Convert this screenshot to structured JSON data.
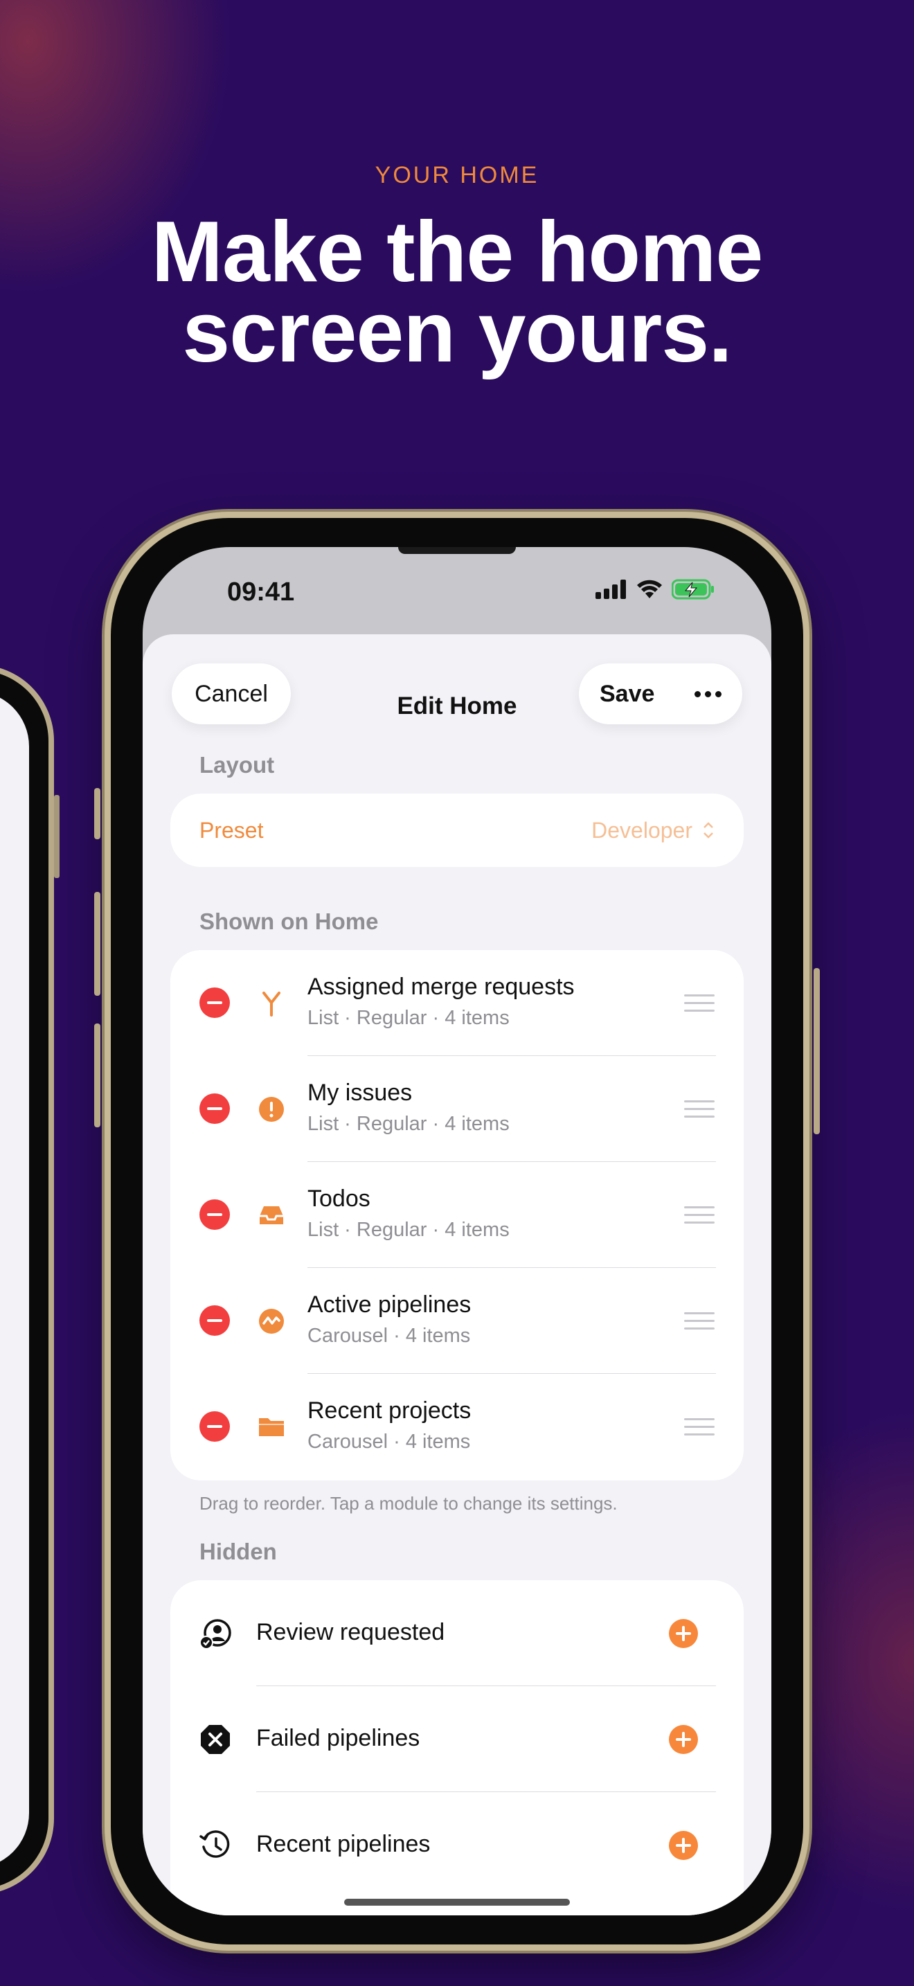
{
  "marketing": {
    "eyebrow": "YOUR HOME",
    "headline_line1": "Make the home",
    "headline_line2": "screen yours."
  },
  "status_bar": {
    "time": "09:41"
  },
  "nav": {
    "cancel_label": "Cancel",
    "title": "Edit Home",
    "save_label": "Save"
  },
  "layout": {
    "section_label": "Layout",
    "preset_label": "Preset",
    "preset_value": "Developer"
  },
  "shown": {
    "section_label": "Shown on Home",
    "items": [
      {
        "title": "Assigned merge requests",
        "subtitle": "List · Regular · 4 items",
        "icon": "merge-request-icon"
      },
      {
        "title": "My issues",
        "subtitle": "List · Regular · 4 items",
        "icon": "issue-icon"
      },
      {
        "title": "Todos",
        "subtitle": "List · Regular · 4 items",
        "icon": "inbox-tray-icon"
      },
      {
        "title": "Active pipelines",
        "subtitle": "Carousel · 4 items",
        "icon": "pipeline-icon"
      },
      {
        "title": "Recent projects",
        "subtitle": "Carousel · 4 items",
        "icon": "folder-icon"
      }
    ],
    "footnote": "Drag to reorder. Tap a module to change its settings."
  },
  "hidden": {
    "section_label": "Hidden",
    "items": [
      {
        "title": "Review requested",
        "icon": "review-user-icon"
      },
      {
        "title": "Failed pipelines",
        "icon": "failed-x-icon"
      },
      {
        "title": "Recent pipelines",
        "icon": "history-clock-icon"
      }
    ]
  },
  "colors": {
    "accent": "#f08a3c",
    "remove": "#f23e3e",
    "background": "#2a0b5e"
  }
}
